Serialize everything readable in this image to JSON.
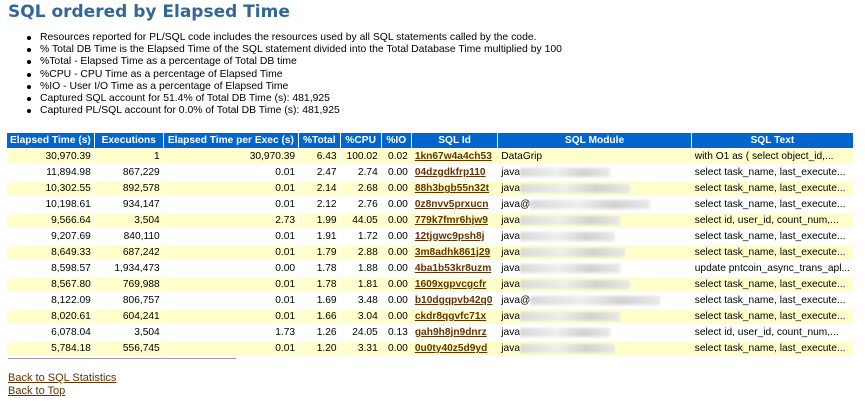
{
  "title": "SQL ordered by Elapsed Time",
  "notes": [
    "Resources reported for PL/SQL code includes the resources used by all SQL statements called by the code.",
    "% Total DB Time is the Elapsed Time of the SQL statement divided into the Total Database Time multiplied by 100",
    "%Total - Elapsed Time as a percentage of Total DB time",
    "%CPU - CPU Time as a percentage of Elapsed Time",
    "%IO - User I/O Time as a percentage of Elapsed Time",
    "Captured SQL account for 51.4% of Total DB Time (s): 481,925",
    "Captured PL/SQL account for 0.0% of Total DB Time (s): 481,925"
  ],
  "table": {
    "headers": [
      "Elapsed Time (s)",
      "Executions",
      "Elapsed Time per Exec (s)",
      "%Total",
      "%CPU",
      "%IO",
      "SQL Id",
      "SQL Module",
      "SQL Text"
    ],
    "rows": [
      {
        "elapsed": "30,970.39",
        "execs": "1",
        "per_exec": "30,970.39",
        "total": "6.43",
        "cpu": "100.02",
        "io": "0.02",
        "sql_id": "1kn67w4a4ch53",
        "module": "DataGrip",
        "text": "with O1 as ( select object_id,..."
      },
      {
        "elapsed": "11,894.98",
        "execs": "867,229",
        "per_exec": "0.01",
        "total": "2.47",
        "cpu": "2.74",
        "io": "0.00",
        "sql_id": "04dzgdkfrp110",
        "module": "java",
        "text": "select task_name, last_execute..."
      },
      {
        "elapsed": "10,302.55",
        "execs": "892,578",
        "per_exec": "0.01",
        "total": "2.14",
        "cpu": "2.68",
        "io": "0.00",
        "sql_id": "88h3bgb55n32t",
        "module": "java",
        "text": "select task_name, last_execute..."
      },
      {
        "elapsed": "10,198.61",
        "execs": "934,147",
        "per_exec": "0.01",
        "total": "2.12",
        "cpu": "2.76",
        "io": "0.00",
        "sql_id": "0z8nvv5prxucn",
        "module": "java@",
        "text": "select task_name, last_execute..."
      },
      {
        "elapsed": "9,566.64",
        "execs": "3,504",
        "per_exec": "2.73",
        "total": "1.99",
        "cpu": "44.05",
        "io": "0.00",
        "sql_id": "779k7fmr6hjw9",
        "module": "java",
        "text": "select id, user_id, count_num,..."
      },
      {
        "elapsed": "9,207.69",
        "execs": "840,110",
        "per_exec": "0.01",
        "total": "1.91",
        "cpu": "1.72",
        "io": "0.00",
        "sql_id": "12tjgwc9psh8j",
        "module": "java",
        "text": "select task_name, last_execute..."
      },
      {
        "elapsed": "8,649.33",
        "execs": "687,242",
        "per_exec": "0.01",
        "total": "1.79",
        "cpu": "2.88",
        "io": "0.00",
        "sql_id": "3m8adhk861j29",
        "module": "java",
        "text": "select task_name, last_execute..."
      },
      {
        "elapsed": "8,598.57",
        "execs": "1,934,473",
        "per_exec": "0.00",
        "total": "1.78",
        "cpu": "1.88",
        "io": "0.00",
        "sql_id": "4ba1b53kr8uzm",
        "module": "java",
        "text": "update pntcoin_async_trans_apl..."
      },
      {
        "elapsed": "8,567.80",
        "execs": "769,988",
        "per_exec": "0.01",
        "total": "1.78",
        "cpu": "1.81",
        "io": "0.00",
        "sql_id": "1609xgpvcgcfr",
        "module": "java",
        "text": "select task_name, last_execute..."
      },
      {
        "elapsed": "8,122.09",
        "execs": "806,757",
        "per_exec": "0.01",
        "total": "1.69",
        "cpu": "3.48",
        "io": "0.00",
        "sql_id": "b10dgqpvb42q0",
        "module": "java@",
        "text": "select task_name, last_execute..."
      },
      {
        "elapsed": "8,020.61",
        "execs": "604,241",
        "per_exec": "0.01",
        "total": "1.66",
        "cpu": "3.04",
        "io": "0.00",
        "sql_id": "ckdr8qgvfc71x",
        "module": "java",
        "text": "select task_name, last_execute..."
      },
      {
        "elapsed": "6,078.04",
        "execs": "3,504",
        "per_exec": "1.73",
        "total": "1.26",
        "cpu": "24.05",
        "io": "0.13",
        "sql_id": "gah9h8jn9dnrz",
        "module": "java",
        "text": "select id, user_id, count_num,..."
      },
      {
        "elapsed": "5,784.18",
        "execs": "556,745",
        "per_exec": "0.01",
        "total": "1.20",
        "cpu": "3.31",
        "io": "0.00",
        "sql_id": "0u0ty40z5d9yd",
        "module": "java",
        "text": "select task_name, last_execute..."
      }
    ]
  },
  "links": {
    "back_to_sql_statistics": "Back to SQL Statistics",
    "back_to_top": "Back to Top"
  },
  "colors": {
    "title": "#336699",
    "header_bg": "#0066cc",
    "row_odd": "#ffffcc",
    "link": "#663300"
  }
}
